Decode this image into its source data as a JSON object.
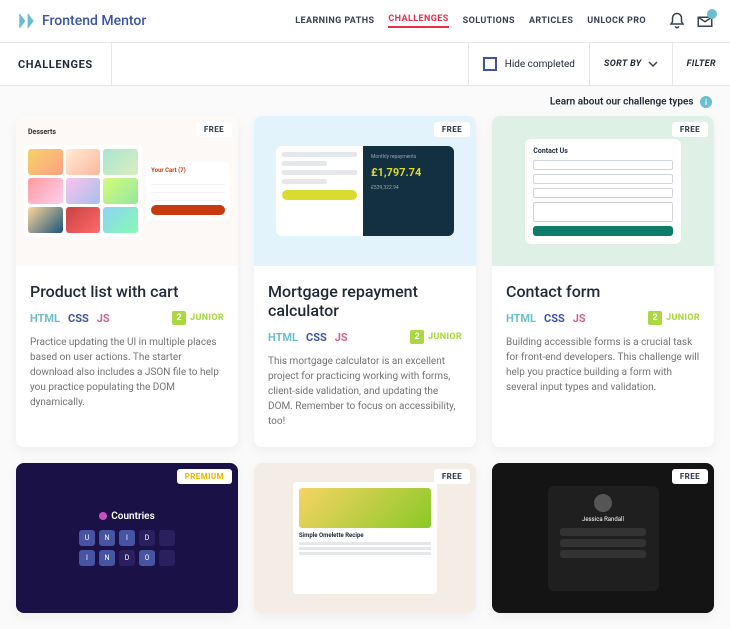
{
  "brand": "Frontend Mentor",
  "nav": {
    "learning": "LEARNING PATHS",
    "challenges": "CHALLENGES",
    "solutions": "SOLUTIONS",
    "articles": "ARTICLES",
    "unlock": "UNLOCK PRO"
  },
  "subbar": {
    "title": "CHALLENGES",
    "hide_completed": "Hide completed",
    "sort_by": "SORT BY",
    "filter": "FILTER"
  },
  "learn_text": "Learn about our challenge types",
  "tags": {
    "free": "FREE",
    "premium": "PREMIUM"
  },
  "langs": {
    "html": "HTML",
    "css": "CSS",
    "js": "JS"
  },
  "difficulty": {
    "num": "2",
    "label": "JUNIOR"
  },
  "cards": {
    "c1": {
      "title": "Product list with cart",
      "desc": "Practice updating the UI in multiple places based on user actions. The starter download also includes a JSON file to help you practice populating the DOM dynamically.",
      "preview_label": "Desserts",
      "cart_title": "Your Cart (7)"
    },
    "c2": {
      "title": "Mortgage repayment calculator",
      "desc": "This mortgage calculator is an excellent project for practicing working with forms, client-side validation, and updating the DOM. Remember to focus on accessibility, too!",
      "amount": "£1,797.74"
    },
    "c3": {
      "title": "Contact form",
      "desc": "Building accessible forms is a crucial task for front-end developers. This challenge will help you practice building a form with several input types and validation.",
      "form_title": "Contact Us"
    },
    "c4": {
      "title": "Countries",
      "letters": [
        "U",
        "N",
        "I",
        "D",
        "",
        "I",
        "N",
        "D",
        "O",
        ""
      ]
    },
    "c5": {
      "title": "Simple Omelette Recipe"
    },
    "c6": {
      "name": "Jessica Randall"
    }
  }
}
